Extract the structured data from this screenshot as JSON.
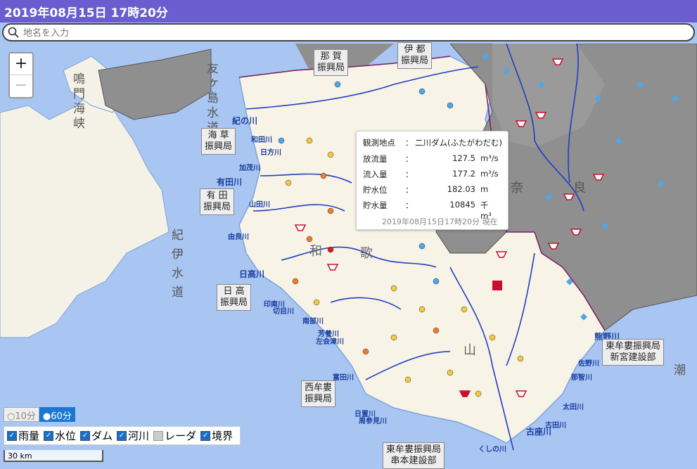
{
  "header": {
    "datetime": "2019年08月15日 17時20分"
  },
  "search": {
    "placeholder": "地名を入力"
  },
  "zoom": {
    "in": "+",
    "out": "−"
  },
  "offices": [
    {
      "id": "naga",
      "lines": [
        "那 賀",
        "振興局"
      ]
    },
    {
      "id": "ito",
      "lines": [
        "伊 都",
        "振興局"
      ]
    },
    {
      "id": "kaiso",
      "lines": [
        "海 草",
        "振興局"
      ]
    },
    {
      "id": "arida",
      "lines": [
        "有 田",
        "振興局"
      ]
    },
    {
      "id": "hidaka",
      "lines": [
        "日 高",
        "振興局"
      ]
    },
    {
      "id": "nishimuro",
      "lines": [
        "西牟婁",
        "振興局"
      ]
    },
    {
      "id": "higashimuro_shingu",
      "lines": [
        "東牟婁振興局",
        "新宮建設部"
      ]
    },
    {
      "id": "higashimuro_kushimoto",
      "lines": [
        "東牟婁振興局",
        "串本建設部"
      ]
    }
  ],
  "rivers": [
    "紀の川",
    "和田川",
    "日方川",
    "加茂川",
    "有田川",
    "山田川",
    "由良川",
    "日高川",
    "印南川",
    "切目川",
    "南部川",
    "芳養川",
    "左会津川",
    "富田川",
    "日置川",
    "周参見川",
    "熊野川",
    "佐野川",
    "那智川",
    "太田川",
    "古座川",
    "古田川",
    "くしの川"
  ],
  "sea_labels": [
    "友ヶ島水道",
    "紀伊水道",
    "鳴門海峡",
    "潮"
  ],
  "land_labels": [
    "和",
    "歌",
    "山",
    "奈",
    "良"
  ],
  "popup": {
    "rows": [
      {
        "key": "観測地点",
        "value": "二川ダム(ふたがわだむ)",
        "unit": ""
      },
      {
        "key": "放流量",
        "value": "127.5",
        "unit": "m³/s"
      },
      {
        "key": "流入量",
        "value": "177.2",
        "unit": "m³/s"
      },
      {
        "key": "貯水位",
        "value": "182.03",
        "unit": "m"
      },
      {
        "key": "貯水量",
        "value": "10845",
        "unit": "千 m³"
      }
    ],
    "footer": "2019年08月15日17時20分 現在"
  },
  "period": {
    "options": [
      "10分",
      "60分"
    ],
    "selected": "60分"
  },
  "layers": [
    {
      "label": "雨量",
      "checked": true
    },
    {
      "label": "水位",
      "checked": true
    },
    {
      "label": "ダム",
      "checked": true
    },
    {
      "label": "河川",
      "checked": true
    },
    {
      "label": "レーダ",
      "checked": false
    },
    {
      "label": "境界",
      "checked": true
    }
  ],
  "scale": "30 km",
  "colors": {
    "header": "#6b5ccf",
    "sea": "#a9c6f2",
    "land": "#f7f3e7",
    "grey_area": "#8f8f8f",
    "river": "#1f3fbf",
    "dam": "#c8102e"
  }
}
